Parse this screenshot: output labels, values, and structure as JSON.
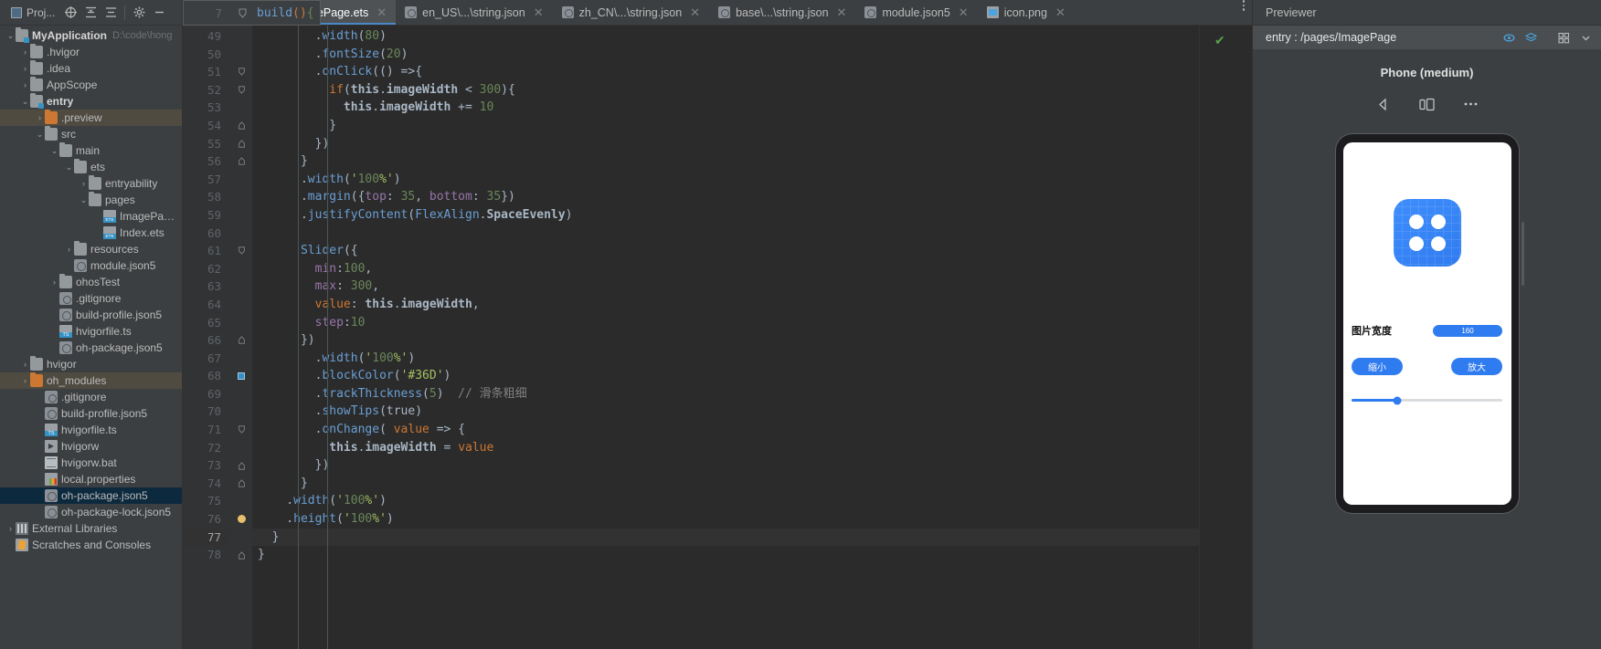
{
  "toolbar": {
    "project_label": "Proj...",
    "icons": [
      "target-icon",
      "collapse-all-icon",
      "expand-all-icon",
      "gear-icon",
      "minimize-icon"
    ],
    "breadcrumb_line": "7",
    "breadcrumb_code": "build(){",
    "more_icon": "vertical-dots-icon"
  },
  "tabs": [
    {
      "label": "gePage.ets",
      "icon": "ets-file-icon",
      "type": "ets",
      "active": true
    },
    {
      "label": "en_US\\...\\string.json",
      "icon": "json5-file-icon",
      "type": "json5",
      "active": false
    },
    {
      "label": "zh_CN\\...\\string.json",
      "icon": "json5-file-icon",
      "type": "json5",
      "active": false
    },
    {
      "label": "base\\...\\string.json",
      "icon": "json5-file-icon",
      "type": "json5",
      "active": false
    },
    {
      "label": "module.json5",
      "icon": "json5-file-icon",
      "type": "json5",
      "active": false
    },
    {
      "label": "icon.png",
      "icon": "png-file-icon",
      "type": "png",
      "active": false
    }
  ],
  "sidebar": {
    "items": [
      {
        "label": "MyApplication",
        "path": "D:\\code\\hong",
        "indent": 0,
        "arrow": "down",
        "icon": "folder-module",
        "bold": true,
        "sel": ""
      },
      {
        "label": ".hvigor",
        "indent": 1,
        "arrow": "right",
        "icon": "folder",
        "sel": ""
      },
      {
        "label": ".idea",
        "indent": 1,
        "arrow": "right",
        "icon": "folder",
        "sel": ""
      },
      {
        "label": "AppScope",
        "indent": 1,
        "arrow": "right",
        "icon": "folder",
        "sel": ""
      },
      {
        "label": "entry",
        "indent": 1,
        "arrow": "down",
        "icon": "folder-module",
        "bold": true,
        "sel": ""
      },
      {
        "label": ".preview",
        "indent": 2,
        "arrow": "right",
        "icon": "folder-orange",
        "sel": "olive"
      },
      {
        "label": "src",
        "indent": 2,
        "arrow": "down",
        "icon": "folder",
        "sel": ""
      },
      {
        "label": "main",
        "indent": 3,
        "arrow": "down",
        "icon": "folder",
        "sel": ""
      },
      {
        "label": "ets",
        "indent": 4,
        "arrow": "down",
        "icon": "folder",
        "sel": ""
      },
      {
        "label": "entryability",
        "indent": 5,
        "arrow": "right",
        "icon": "folder",
        "sel": ""
      },
      {
        "label": "pages",
        "indent": 5,
        "arrow": "down",
        "icon": "folder",
        "sel": ""
      },
      {
        "label": "ImagePage.",
        "indent": 6,
        "arrow": "none",
        "icon": "ets-file",
        "sel": ""
      },
      {
        "label": "Index.ets",
        "indent": 6,
        "arrow": "none",
        "icon": "ets-file",
        "sel": ""
      },
      {
        "label": "resources",
        "indent": 4,
        "arrow": "right",
        "icon": "folder",
        "sel": ""
      },
      {
        "label": "module.json5",
        "indent": 4,
        "arrow": "none",
        "icon": "json5-file",
        "sel": ""
      },
      {
        "label": "ohosTest",
        "indent": 3,
        "arrow": "right",
        "icon": "folder",
        "sel": ""
      },
      {
        "label": ".gitignore",
        "indent": 3,
        "arrow": "none",
        "icon": "git-file",
        "sel": ""
      },
      {
        "label": "build-profile.json5",
        "indent": 3,
        "arrow": "none",
        "icon": "json5-file",
        "sel": ""
      },
      {
        "label": "hvigorfile.ts",
        "indent": 3,
        "arrow": "none",
        "icon": "ts-file",
        "sel": ""
      },
      {
        "label": "oh-package.json5",
        "indent": 3,
        "arrow": "none",
        "icon": "json5-file",
        "sel": ""
      },
      {
        "label": "hvigor",
        "indent": 1,
        "arrow": "right",
        "icon": "folder",
        "sel": ""
      },
      {
        "label": "oh_modules",
        "indent": 1,
        "arrow": "right",
        "icon": "folder-orange",
        "sel": "olive"
      },
      {
        "label": ".gitignore",
        "indent": 2,
        "arrow": "none",
        "icon": "git-file",
        "sel": ""
      },
      {
        "label": "build-profile.json5",
        "indent": 2,
        "arrow": "none",
        "icon": "json5-file",
        "sel": ""
      },
      {
        "label": "hvigorfile.ts",
        "indent": 2,
        "arrow": "none",
        "icon": "ts-file",
        "sel": ""
      },
      {
        "label": "hvigorw",
        "indent": 2,
        "arrow": "none",
        "icon": "exe-file",
        "sel": ""
      },
      {
        "label": "hvigorw.bat",
        "indent": 2,
        "arrow": "none",
        "icon": "bat-file",
        "sel": ""
      },
      {
        "label": "local.properties",
        "indent": 2,
        "arrow": "none",
        "icon": "properties-file",
        "sel": ""
      },
      {
        "label": "oh-package.json5",
        "indent": 2,
        "arrow": "none",
        "icon": "json5-file",
        "sel": "blue"
      },
      {
        "label": "oh-package-lock.json5",
        "indent": 2,
        "arrow": "none",
        "icon": "json5-file",
        "sel": ""
      },
      {
        "label": "External Libraries",
        "indent": 0,
        "arrow": "right",
        "icon": "library",
        "sel": ""
      },
      {
        "label": "Scratches and Consoles",
        "indent": 0,
        "arrow": "none",
        "icon": "scratch",
        "sel": ""
      }
    ]
  },
  "editor": {
    "lines": [
      {
        "n": "49",
        "fold": "",
        "mark": "",
        "text": "        .width(80)"
      },
      {
        "n": "50",
        "fold": "",
        "mark": "",
        "text": "        .fontSize(20)"
      },
      {
        "n": "51",
        "fold": "down",
        "mark": "",
        "text": "        .onClick(() =>{"
      },
      {
        "n": "52",
        "fold": "down",
        "mark": "",
        "text": "          if(this.imageWidth < 300){"
      },
      {
        "n": "53",
        "fold": "",
        "mark": "",
        "text": "            this.imageWidth += 10"
      },
      {
        "n": "54",
        "fold": "up",
        "mark": "",
        "text": "          }"
      },
      {
        "n": "55",
        "fold": "up",
        "mark": "",
        "text": "        })"
      },
      {
        "n": "56",
        "fold": "up",
        "mark": "",
        "text": "      }"
      },
      {
        "n": "57",
        "fold": "",
        "mark": "",
        "text": "      .width('100%')"
      },
      {
        "n": "58",
        "fold": "",
        "mark": "",
        "text": "      .margin({top: 35, bottom: 35})"
      },
      {
        "n": "59",
        "fold": "",
        "mark": "",
        "text": "      .justifyContent(FlexAlign.SpaceEvenly)"
      },
      {
        "n": "60",
        "fold": "",
        "mark": "",
        "text": ""
      },
      {
        "n": "61",
        "fold": "down",
        "mark": "",
        "text": "      Slider({"
      },
      {
        "n": "62",
        "fold": "",
        "mark": "",
        "text": "        min:100,"
      },
      {
        "n": "63",
        "fold": "",
        "mark": "",
        "text": "        max: 300,"
      },
      {
        "n": "64",
        "fold": "",
        "mark": "",
        "text": "        value: this.imageWidth,"
      },
      {
        "n": "65",
        "fold": "",
        "mark": "",
        "text": "        step:10"
      },
      {
        "n": "66",
        "fold": "up",
        "mark": "",
        "text": "      })"
      },
      {
        "n": "67",
        "fold": "",
        "mark": "",
        "text": "        .width('100%')"
      },
      {
        "n": "68",
        "fold": "",
        "mark": "blue-block",
        "text": "        .blockColor('#36D')"
      },
      {
        "n": "69",
        "fold": "",
        "mark": "",
        "text": "        .trackThickness(5)  // 滑条粗细"
      },
      {
        "n": "70",
        "fold": "",
        "mark": "",
        "text": "        .showTips(true)"
      },
      {
        "n": "71",
        "fold": "down",
        "mark": "",
        "text": "        .onChange( value => {"
      },
      {
        "n": "72",
        "fold": "",
        "mark": "",
        "text": "          this.imageWidth = value"
      },
      {
        "n": "73",
        "fold": "up",
        "mark": "",
        "text": "        })"
      },
      {
        "n": "74",
        "fold": "up",
        "mark": "",
        "text": "      }"
      },
      {
        "n": "75",
        "fold": "",
        "mark": "",
        "text": "    .width('100%')"
      },
      {
        "n": "76",
        "fold": "",
        "mark": "breakpoint",
        "text": "    .height('100%')"
      },
      {
        "n": "77",
        "fold": "",
        "mark": "",
        "text": "  }",
        "current": true
      },
      {
        "n": "78",
        "fold": "up",
        "mark": "",
        "text": "}"
      }
    ],
    "inspection_status": "check-ok"
  },
  "previewer": {
    "title": "Previewer",
    "path": "entry : /pages/ImagePage",
    "tools": [
      "refresh-icon",
      "layers-icon",
      "grid-icon",
      "chevron-down-icon"
    ],
    "device": "Phone (medium)",
    "controls": [
      "rotate-left-icon",
      "multi-device-icon",
      "more-dots-icon"
    ],
    "phone": {
      "app_icon": "app-grid-icon",
      "width_label": "图片宽度",
      "tip_value": "160",
      "buttons": [
        "缩小",
        "放大"
      ],
      "slider_percent": 30
    }
  },
  "colors": {
    "accent_blue": "#3592c4",
    "preview_blue": "#2f7bf0",
    "selection_olive": "#4f4b41",
    "selection_blue": "#0d293e",
    "editor_bg": "#2b2b2b",
    "panel_bg": "#3c3f41"
  }
}
